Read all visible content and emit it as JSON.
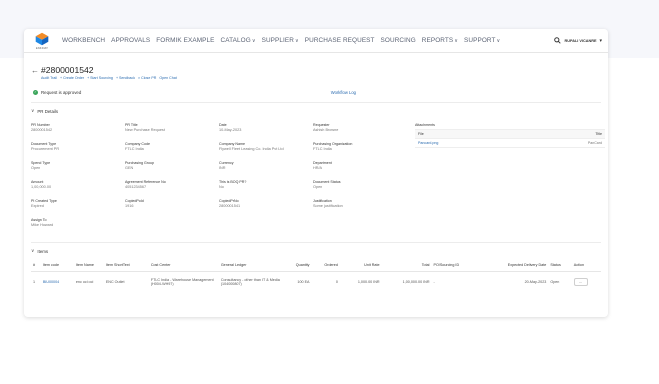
{
  "nav": {
    "logo_text": "ENKINAT",
    "items": [
      {
        "label": "WORKBENCH",
        "has_dropdown": false
      },
      {
        "label": "APPROVALS",
        "has_dropdown": false
      },
      {
        "label": "FORMIK EXAMPLE",
        "has_dropdown": false
      },
      {
        "label": "CATALOG",
        "has_dropdown": true
      },
      {
        "label": "SUPPLIER",
        "has_dropdown": true
      },
      {
        "label": "PURCHASE REQUEST",
        "has_dropdown": false
      },
      {
        "label": "SOURCING",
        "has_dropdown": false
      },
      {
        "label": "REPORTS",
        "has_dropdown": true
      },
      {
        "label": "SUPPORT",
        "has_dropdown": true
      }
    ],
    "user": "RUPALI VICANRE",
    "chevron_glyph": "∨"
  },
  "po": {
    "number": "#2800001542",
    "actions": [
      "Audit Trail",
      "+ Create Order",
      "+ Start Sourcing",
      "+ Sendback",
      "× Close PR",
      "Open Chat"
    ]
  },
  "status": {
    "text": "Request is approved",
    "workflow_link": "Workflow Log"
  },
  "pr_details": {
    "title": "PR Details",
    "fields": [
      {
        "label": "PR Number",
        "value": "2800001542"
      },
      {
        "label": "PR Title",
        "value": "New Purchase Request"
      },
      {
        "label": "Date",
        "value": "10-May-2023"
      },
      {
        "label": "Requester",
        "value": "Ashish Browne"
      },
      {
        "label": "Document Type",
        "value": "Procurement PR"
      },
      {
        "label": "Company Code",
        "value": "FTLC India"
      },
      {
        "label": "Company Name",
        "value": "Flywell Fleet Leasing Co. India Pvt Ltd"
      },
      {
        "label": "Purchasing Organization",
        "value": "FTLC India"
      },
      {
        "label": "Spend Type",
        "value": "Open"
      },
      {
        "label": "Purchasing Group",
        "value": "GEN"
      },
      {
        "label": "Currency",
        "value": "INR"
      },
      {
        "label": "Department",
        "value": "HR/A"
      },
      {
        "label": "Amount",
        "value": "1,00,000.00"
      },
      {
        "label": "Agreement Reference No",
        "value": "4051234567"
      },
      {
        "label": "This is BOQ PR?",
        "value": "No"
      },
      {
        "label": "Document Status",
        "value": "Open"
      },
      {
        "label": "PI Created Type",
        "value": "Expired"
      },
      {
        "label": "CopiedPoId",
        "value": "1916"
      },
      {
        "label": "CopiedPrNo",
        "value": "2800001541"
      },
      {
        "label": "Justification",
        "value": "Some justification"
      },
      {
        "label": "Assign To",
        "value": "Mike Howard"
      }
    ],
    "attachments": {
      "label": "Attachments",
      "columns": [
        "File",
        "Title"
      ],
      "rows": [
        {
          "file": "Pancard.png",
          "title": "PanCard"
        }
      ]
    }
  },
  "items": {
    "title": "Items",
    "columns": [
      "#",
      "Item code",
      "Item Name",
      "Item ShortText",
      "Cost Center",
      "General Ledger",
      "Quantity",
      "Ordered",
      "Unit Rate",
      "Total",
      "PO/Sourcing ID",
      "Expected Delivery Date",
      "Status",
      "Action"
    ],
    "rows": [
      {
        "index": "1",
        "item_code": "BIU00004",
        "item_name": "enc oci oci",
        "item_short_text": "ENC Outlet",
        "cost_center": "FTLC India - Warehouse Management (H004-WH97)",
        "general_ledger": "Consultancy - other than IT & Media (104000807)",
        "quantity": "100 EA",
        "ordered": "0",
        "unit_rate": "1,000.00 INR",
        "total": "1,00,000.00 INR",
        "po_sourcing_id": "-",
        "expected_delivery": "20-May-2023",
        "status": "Open",
        "action": "..."
      }
    ]
  }
}
